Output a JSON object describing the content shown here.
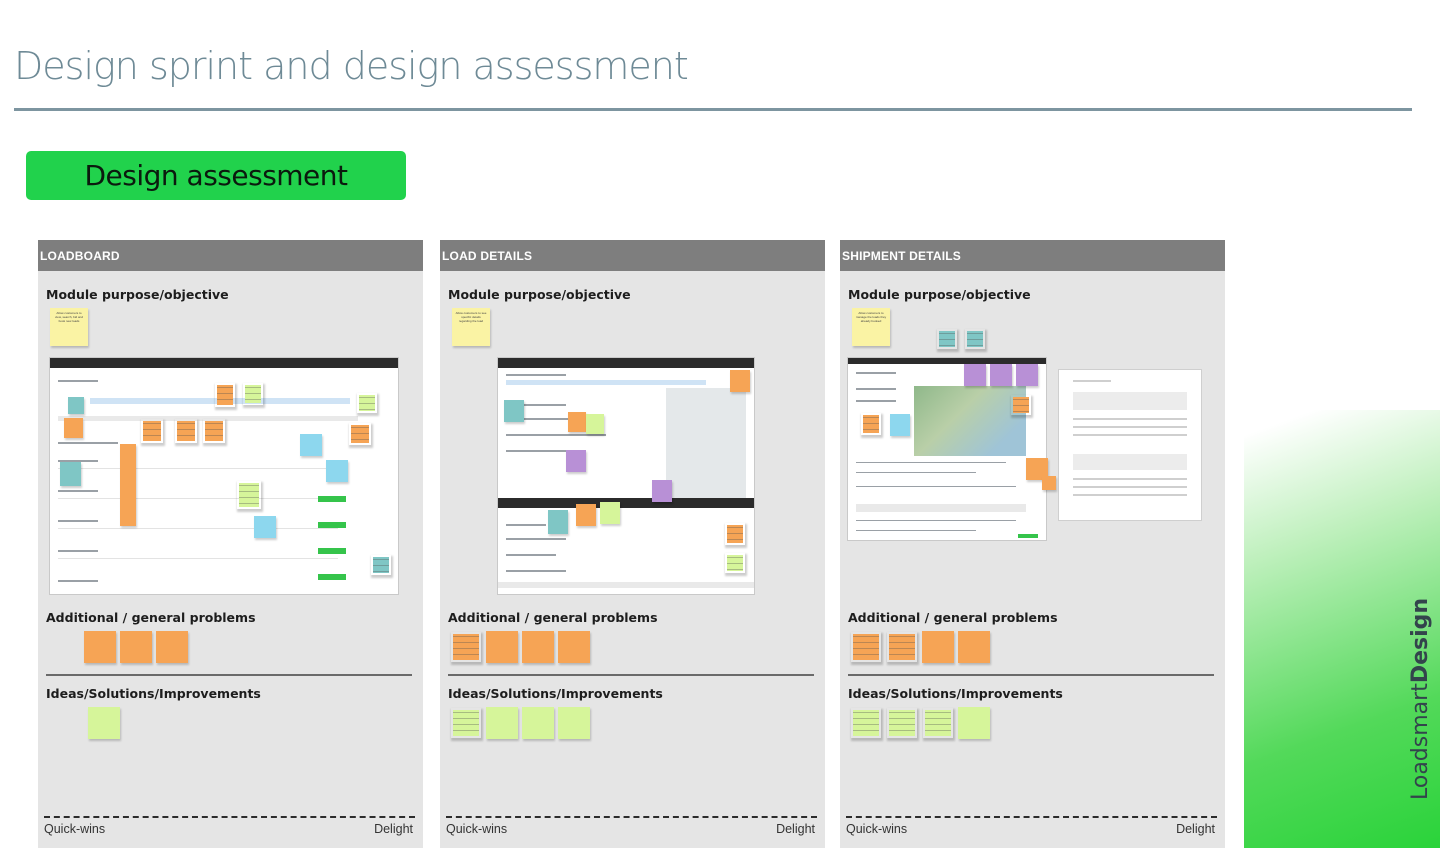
{
  "page": {
    "title": "Design sprint and design assessment",
    "badge": "Design assessment",
    "brand_light": "Loadsmart",
    "brand_bold": "Design"
  },
  "colors": {
    "badge": "#21d24c",
    "title": "#6e8a96",
    "panel_header": "#7e7e7e",
    "panel_bg": "#e5e5e5",
    "sticky_yellow": "#faf3a4",
    "sticky_orange": "#f6a455",
    "sticky_green": "#d6f59a",
    "sticky_teal": "#7fc6c5",
    "sticky_purple": "#b890d6",
    "sticky_blue": "#8dd7ee"
  },
  "panels": [
    {
      "header": "LOADBOARD",
      "purpose_label": "Module purpose/objective",
      "purpose_note": "Allow customers to view, search, bid and book new loads",
      "problems_label": "Additional / general problems",
      "ideas_label": "Ideas/Solutions/Improvements",
      "scale_left": "Quick-wins",
      "scale_right": "Delight"
    },
    {
      "header": "LOAD DETAILS",
      "purpose_label": "Module purpose/objective",
      "purpose_note": "Allow customers to see specific details regarding the load",
      "problems_label": "Additional / general problems",
      "ideas_label": "Ideas/Solutions/Improvements",
      "scale_left": "Quick-wins",
      "scale_right": "Delight"
    },
    {
      "header": "SHIPMENT DETAILS",
      "purpose_label": "Module purpose/objective",
      "purpose_note": "Allow customers to manage the loads they already booked",
      "problems_label": "Additional / general problems",
      "ideas_label": "Ideas/Solutions/Improvements",
      "scale_left": "Quick-wins",
      "scale_right": "Delight"
    }
  ]
}
